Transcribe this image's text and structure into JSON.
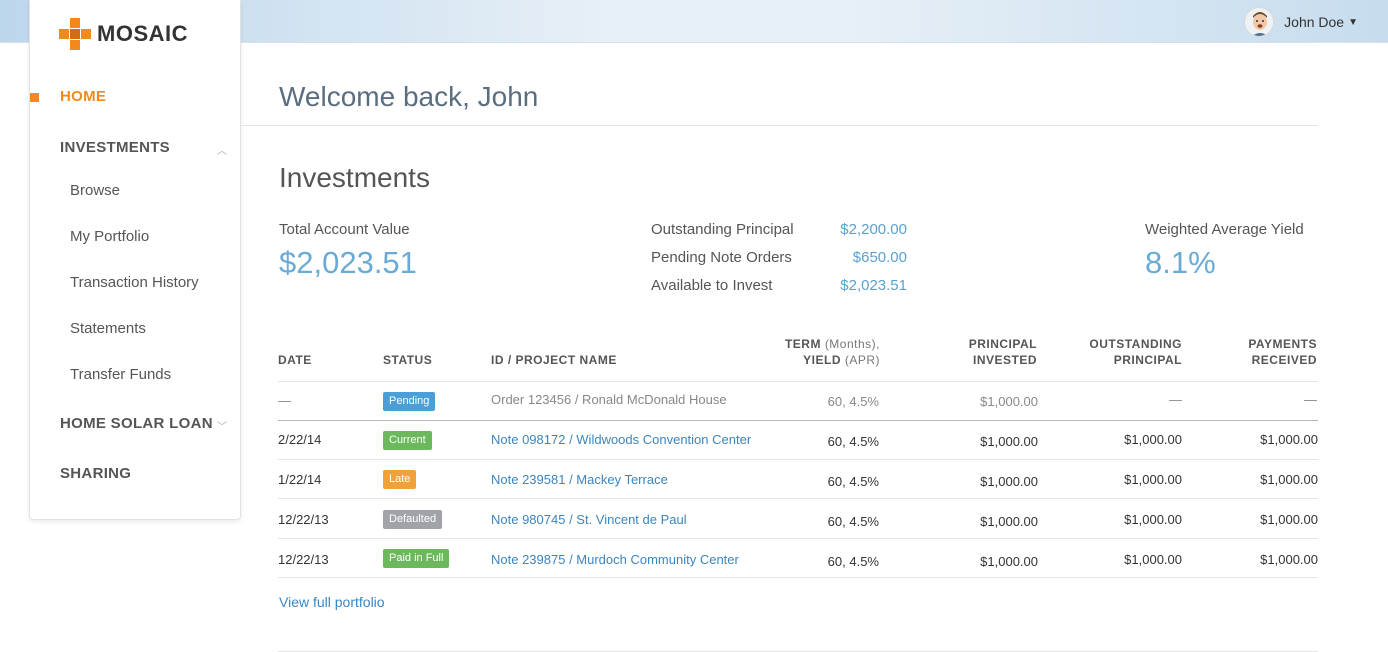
{
  "brand": {
    "name": "MOSAIC",
    "accent": "#f08a1c"
  },
  "user": {
    "name": "John Doe"
  },
  "sidebar": {
    "home": "HOME",
    "investments": "INVESTMENTS",
    "sub_items": [
      "Browse",
      "My Portfolio",
      "Transaction History",
      "Statements",
      "Transfer Funds"
    ],
    "home_solar_loan": "HOME SOLAR LOAN",
    "sharing": "SHARING"
  },
  "main": {
    "welcome": "Welcome back, John",
    "section_title": "Investments",
    "total_account_value_label": "Total Account Value",
    "total_account_value": "$2,023.51",
    "outstanding_principal_label": "Outstanding Principal",
    "outstanding_principal": "$2,200.00",
    "pending_note_orders_label": "Pending Note Orders",
    "pending_note_orders": "$650.00",
    "available_to_invest_label": "Available to Invest",
    "available_to_invest": "$2,023.51",
    "weighted_average_yield_label": "Weighted Average Yield",
    "weighted_average_yield": "8.1%",
    "view_full_portfolio": "View full portfolio"
  },
  "table": {
    "headers": {
      "date": "DATE",
      "status": "STATUS",
      "project": "ID / PROJECT NAME",
      "term_a": "TERM",
      "term_b": "(Months),",
      "yield_a": "YIELD",
      "yield_b": "(APR)",
      "principal_1": "PRINCIPAL",
      "principal_2": "INVESTED",
      "outstanding_1": "OUTSTANDING",
      "outstanding_2": "PRINCIPAL",
      "payments_1": "PAYMENTS",
      "payments_2": "RECEIVED"
    },
    "rows": [
      {
        "date": "—",
        "status": "Pending",
        "project": "Order 123456 / Ronald McDonald House",
        "term": "60, 4.5%",
        "principal": "$1,000.00",
        "outstanding": "—",
        "payments": "—"
      },
      {
        "date": "2/22/14",
        "status": "Current",
        "project": "Note 098172 / Wildwoods Convention Center",
        "term": "60, 4.5%",
        "principal": "$1,000.00",
        "outstanding": "$1,000.00",
        "payments": "$1,000.00"
      },
      {
        "date": "1/22/14",
        "status": "Late",
        "project": "Note 239581 / Mackey Terrace",
        "term": "60, 4.5%",
        "principal": "$1,000.00",
        "outstanding": "$1,000.00",
        "payments": "$1,000.00"
      },
      {
        "date": "12/22/13",
        "status": "Defaulted",
        "project": "Note 980745 / St. Vincent de Paul",
        "term": "60, 4.5%",
        "principal": "$1,000.00",
        "outstanding": "$1,000.00",
        "payments": "$1,000.00"
      },
      {
        "date": "12/22/13",
        "status": "Paid in Full",
        "project": "Note 239875 / Murdoch Community Center",
        "term": "60, 4.5%",
        "principal": "$1,000.00",
        "outstanding": "$1,000.00",
        "payments": "$1,000.00"
      }
    ]
  },
  "icons": {
    "logo": "mosaic-cross-icon",
    "avatar": "user-avatar",
    "dropdown": "caret-down-icon",
    "chevron_up": "chevron-up-icon",
    "chevron_down": "chevron-down-icon"
  }
}
